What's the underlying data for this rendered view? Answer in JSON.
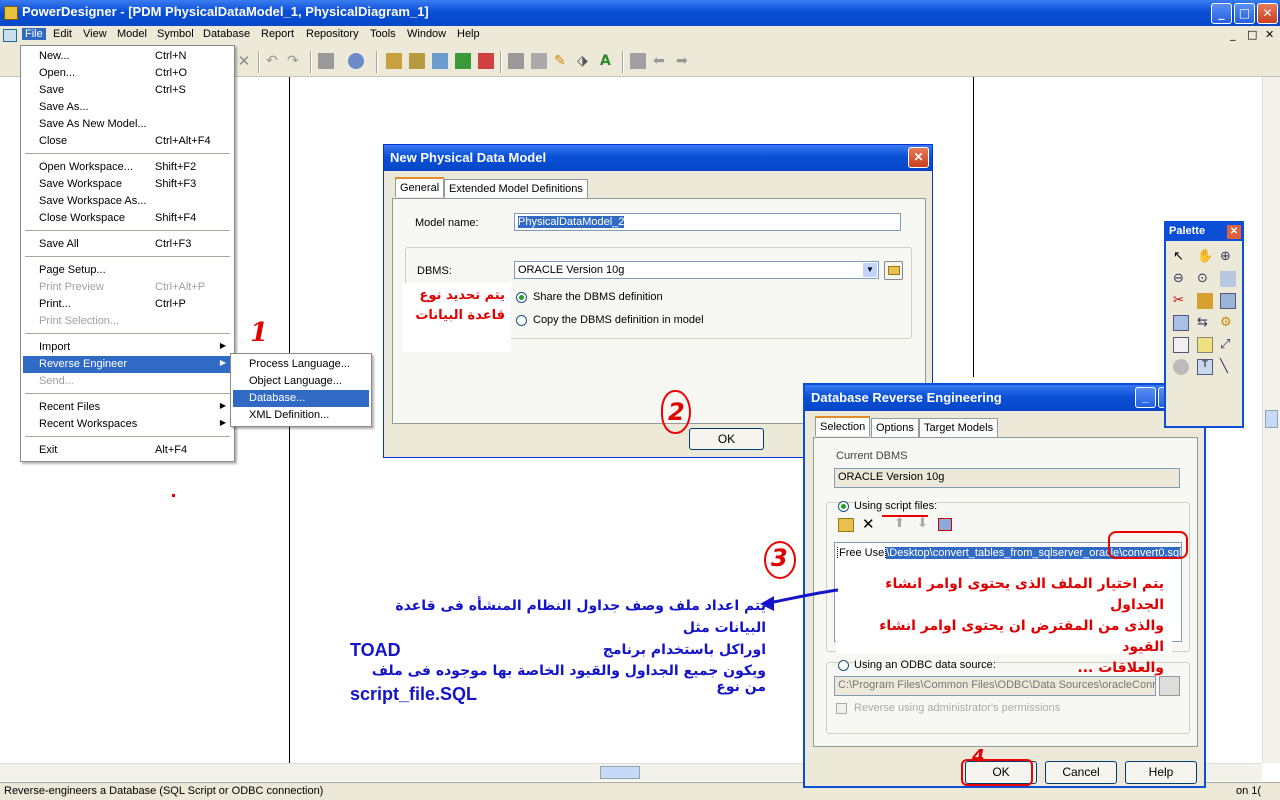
{
  "window": {
    "title": "PowerDesigner - [PDM PhysicalDataModel_1, PhysicalDiagram_1]",
    "minimize": "_",
    "maximize": "□",
    "close": "✕",
    "mdi_controls": [
      "_",
      "□",
      "✕"
    ]
  },
  "menubar": {
    "items": [
      "File",
      "Edit",
      "View",
      "Model",
      "Symbol",
      "Database",
      "Report",
      "Repository",
      "Tools",
      "Window",
      "Help"
    ]
  },
  "file_menu": {
    "items": [
      {
        "label": "New...",
        "shortcut": "Ctrl+N"
      },
      {
        "label": "Open...",
        "shortcut": "Ctrl+O"
      },
      {
        "label": "Save",
        "shortcut": "Ctrl+S"
      },
      {
        "label": "Save As...",
        "shortcut": ""
      },
      {
        "label": "Save As New Model...",
        "shortcut": ""
      },
      {
        "label": "Close",
        "shortcut": "Ctrl+Alt+F4"
      },
      {
        "label": "Open Workspace...",
        "shortcut": "Shift+F2"
      },
      {
        "label": "Save Workspace",
        "shortcut": "Shift+F3"
      },
      {
        "label": "Save Workspace As...",
        "shortcut": ""
      },
      {
        "label": "Close Workspace",
        "shortcut": "Shift+F4"
      },
      {
        "label": "Save All",
        "shortcut": "Ctrl+F3"
      },
      {
        "label": "Page Setup...",
        "shortcut": ""
      },
      {
        "label": "Print Preview",
        "shortcut": "Ctrl+Alt+P"
      },
      {
        "label": "Print...",
        "shortcut": "Ctrl+P"
      },
      {
        "label": "Print Selection...",
        "shortcut": ""
      },
      {
        "label": "Import",
        "shortcut": ""
      },
      {
        "label": "Reverse Engineer",
        "shortcut": ""
      },
      {
        "label": "Send...",
        "shortcut": ""
      },
      {
        "label": "Recent Files",
        "shortcut": ""
      },
      {
        "label": "Recent Workspaces",
        "shortcut": ""
      },
      {
        "label": "Exit",
        "shortcut": "Alt+F4"
      }
    ]
  },
  "reverse_submenu": {
    "items": [
      "Process Language...",
      "Object Language...",
      "Database...",
      "XML Definition..."
    ]
  },
  "new_pdm_dialog": {
    "title": "New Physical Data Model",
    "tabs": [
      "General",
      "Extended Model Definitions"
    ],
    "model_name_label": "Model name:",
    "model_name_value": "PhysicalDataModel_2",
    "dbms_label": "DBMS:",
    "dbms_value": "ORACLE Version 10g",
    "share_option": "Share the DBMS definition",
    "copy_option": "Copy the DBMS definition in model",
    "ok_label": "OK"
  },
  "reverse_dialog": {
    "title": "Database Reverse  Engineering",
    "tabs": [
      "Selection",
      "Options",
      "Target Models"
    ],
    "current_dbms_label": "Current DBMS",
    "current_dbms_value": "ORACLE Version 10g",
    "script_files_label": "Using script files:",
    "script_path_prefix": "Free Use",
    "script_path_value": "\\Desktop\\convert_tables_from_sqlserver_oracle\\convert0.sql",
    "odbc_label": "Using an ODBC data source:",
    "odbc_value": "C:\\Program Files\\Common Files\\ODBC\\Data Sources\\oracleConne",
    "admin_label": "Reverse using administrator's permissions",
    "ok_label": "OK",
    "cancel_label": "Cancel",
    "help_label": "Help"
  },
  "palette": {
    "title": "Palette"
  },
  "annotations": {
    "step1": "1",
    "step2": "2",
    "step3": "3",
    "step4": "4",
    "dbms_note_line1": "يتم تحديد نوع",
    "dbms_note_line2": "قاعدة البيانات",
    "script_note_line1": "يتم اختيار الملف الذى يحتوى اوامر انشاء الجداول",
    "script_note_line2": "والذى من المفترض ان يحتوى اوامر انشاء القيود",
    "script_note_line3": "والعلاقات ...",
    "blue_line1": "يتم اعداد ملف وصف جداول النظام المنشأه فى قاعدة البيانات مثل",
    "blue_line2": "اوراكل باستخدام برنامج",
    "blue_line3": "TOAD",
    "blue_line4": "ويكون جميع الجداول والقيود الخاصة بها موجوده فى ملف من نوع",
    "blue_line5": "script_file.SQL"
  },
  "status": {
    "text": "Reverse-engineers a Database  (SQL Script or ODBC connection)",
    "right_text": "on 1("
  },
  "colors": {
    "xp_blue": "#0a4fd6",
    "menu_highlight": "#316ac5",
    "annotation_red": "#e00000",
    "annotation_blue": "#1414c8"
  }
}
